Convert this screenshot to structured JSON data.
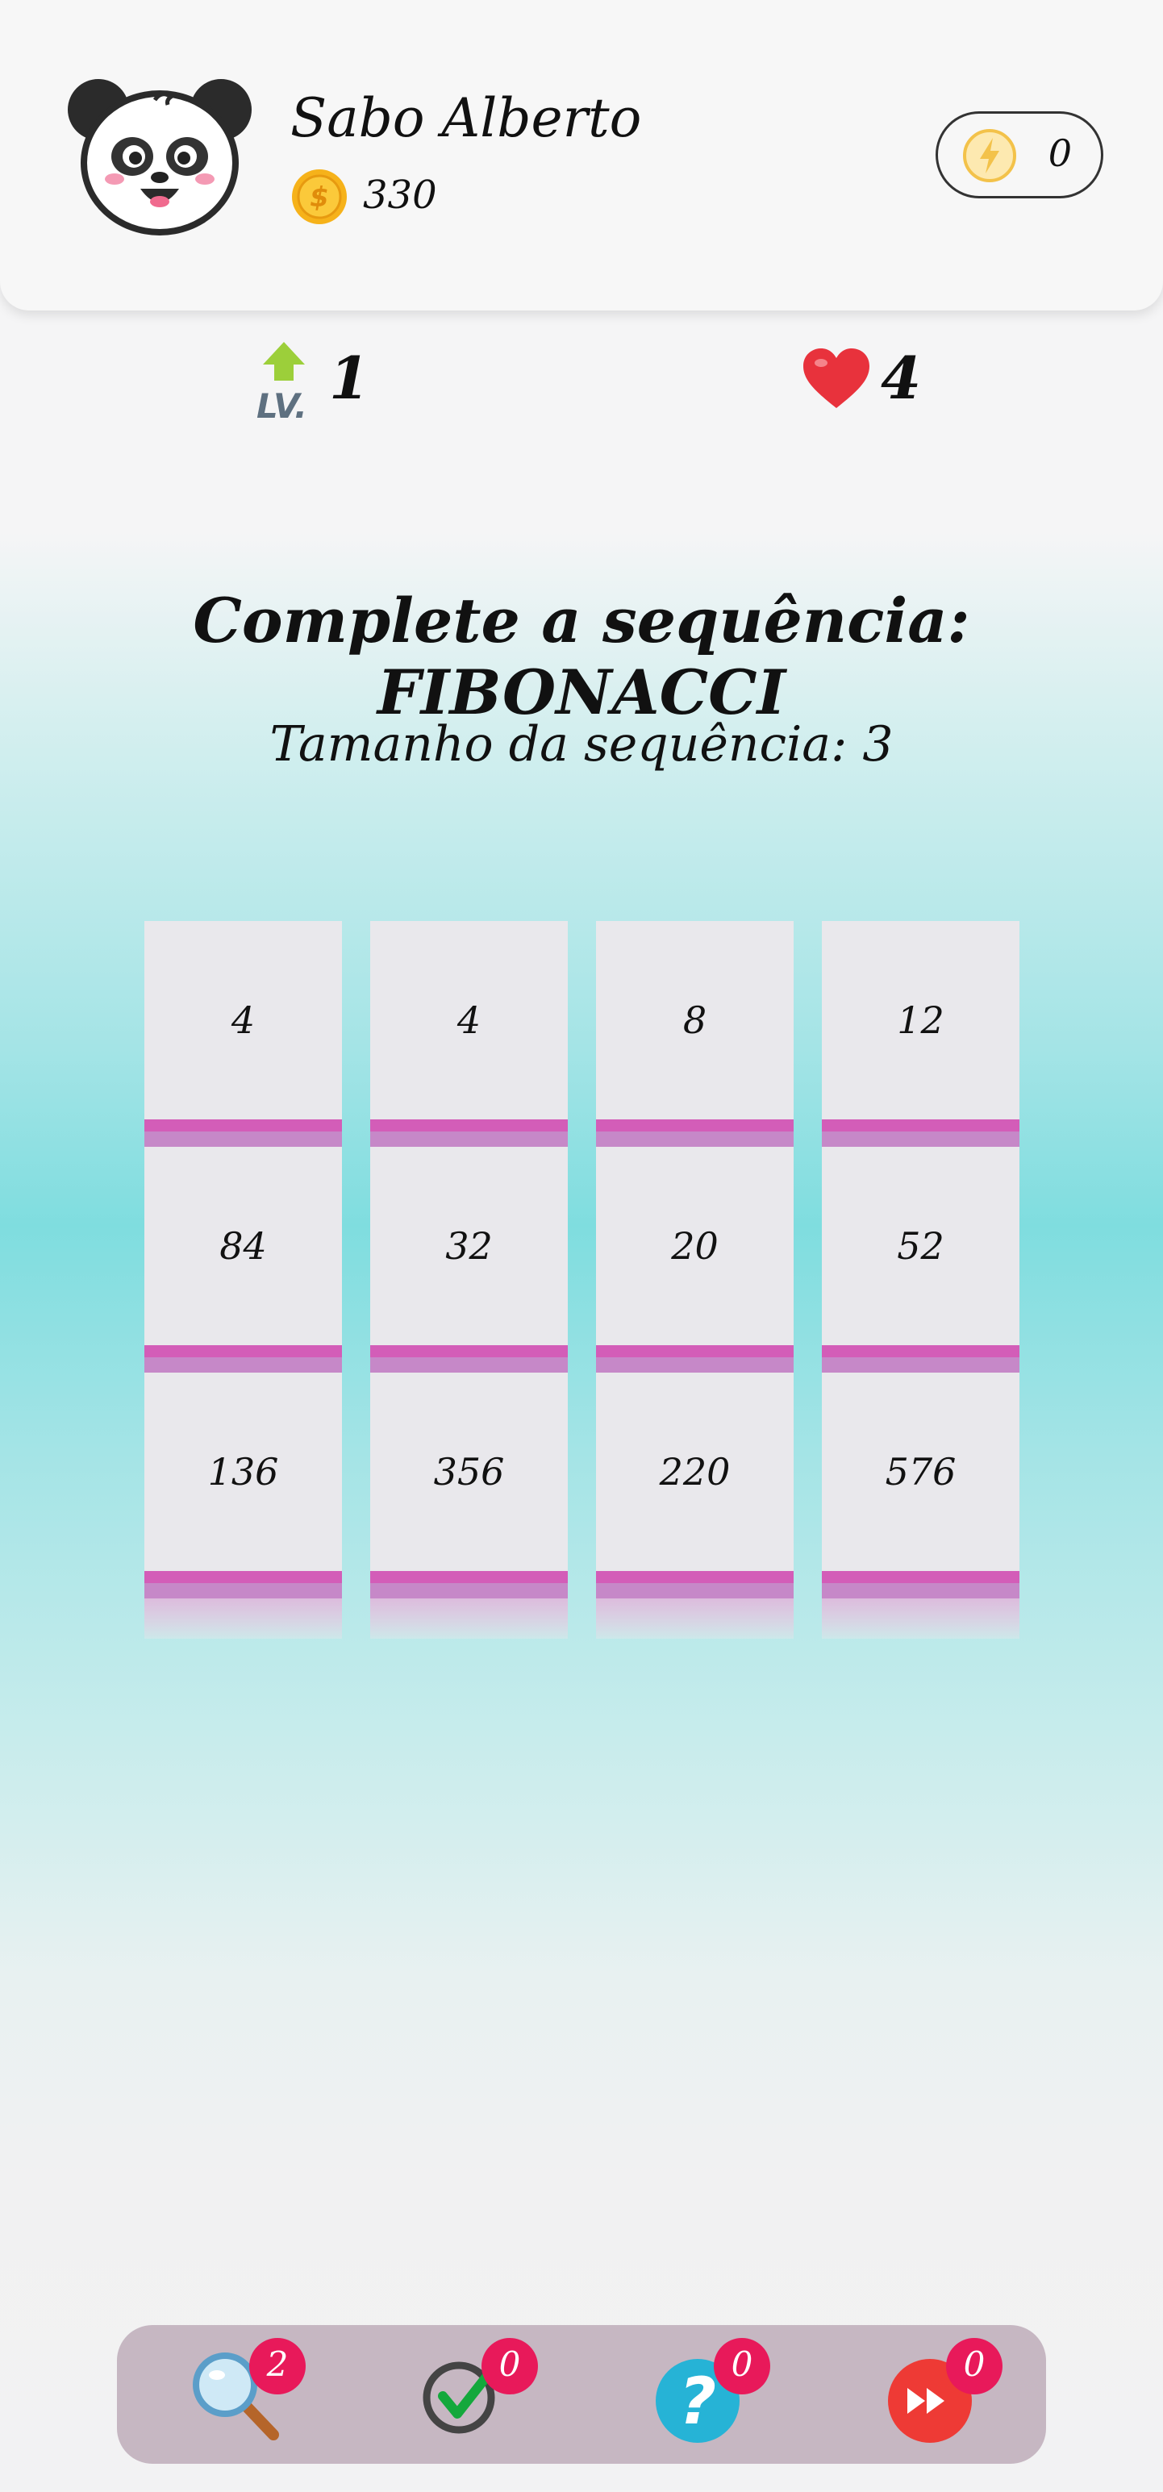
{
  "player": {
    "name": "Sabo Alberto",
    "coins": "330",
    "energy": "0"
  },
  "stats": {
    "level": "1",
    "lives": "4"
  },
  "puzzle": {
    "title": "Complete a sequência: FIBONACCI",
    "subtitle": "Tamanho da sequência: 3",
    "columns": [
      [
        "4",
        "84",
        "136"
      ],
      [
        "4",
        "32",
        "356"
      ],
      [
        "8",
        "20",
        "220"
      ],
      [
        "12",
        "52",
        "576"
      ]
    ]
  },
  "powerups": [
    {
      "icon": "magnifier-icon",
      "count": "2"
    },
    {
      "icon": "checkmark-icon",
      "count": "0"
    },
    {
      "icon": "question-icon",
      "count": "0"
    },
    {
      "icon": "fast-forward-icon",
      "count": "0"
    }
  ],
  "colors": {
    "accent_bar": "#d35db8",
    "badge": "#e8195a",
    "heart": "#e8323c",
    "coin": "#f6b21a",
    "toolbar": "#c6b7c2"
  }
}
